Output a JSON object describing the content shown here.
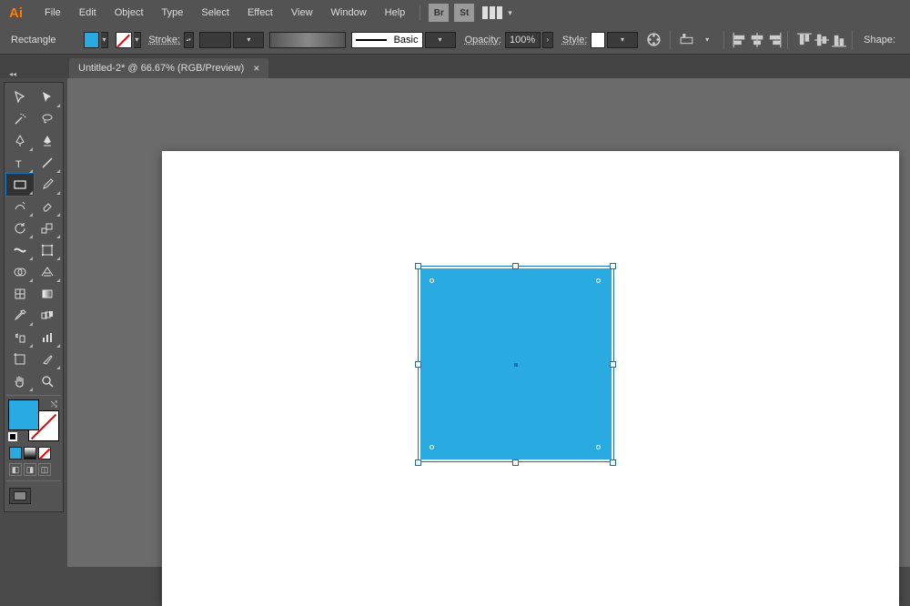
{
  "app": {
    "logo": "Ai"
  },
  "menu": {
    "items": [
      "File",
      "Edit",
      "Object",
      "Type",
      "Select",
      "Effect",
      "View",
      "Window",
      "Help"
    ],
    "br": "Br",
    "st": "St"
  },
  "control": {
    "selection_label": "Rectangle",
    "fill_color": "#29abe2",
    "stroke_label": "Stroke:",
    "brush_label": "Basic",
    "opacity_label": "Opacity:",
    "opacity_value": "100%",
    "style_label": "Style:",
    "shapes_label": "Shape:"
  },
  "document": {
    "tab_title": "Untitled-2* @ 66.67% (RGB/Preview)"
  },
  "tools": {
    "names": [
      [
        "selection",
        "direct-selection"
      ],
      [
        "magic-wand",
        "lasso"
      ],
      [
        "pen",
        "curvature"
      ],
      [
        "type",
        "line-segment"
      ],
      [
        "rectangle",
        "paintbrush"
      ],
      [
        "shaper",
        "eraser"
      ],
      [
        "rotate",
        "scale"
      ],
      [
        "width",
        "free-transform"
      ],
      [
        "shape-builder",
        "perspective-grid"
      ],
      [
        "mesh",
        "gradient"
      ],
      [
        "eyedropper",
        "blend"
      ],
      [
        "symbol-sprayer",
        "column-graph"
      ],
      [
        "artboard",
        "slice"
      ],
      [
        "hand",
        "zoom"
      ]
    ],
    "active": "rectangle"
  },
  "canvas": {
    "rect": {
      "fill": "#29abe2"
    }
  }
}
